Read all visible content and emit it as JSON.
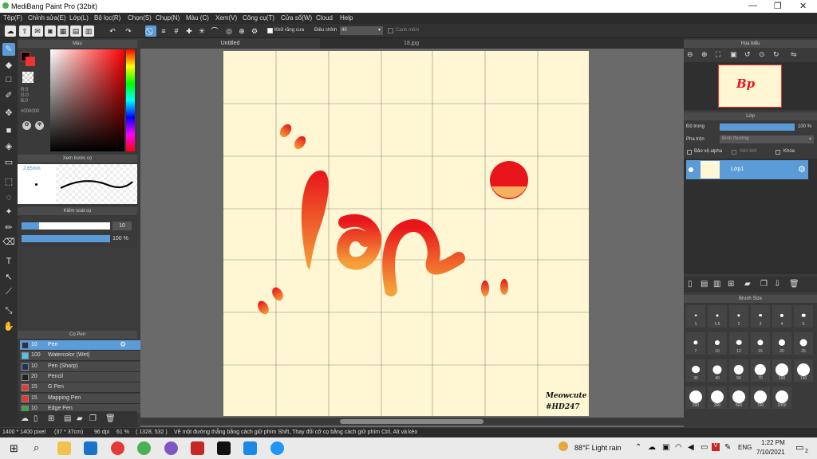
{
  "window": {
    "title": "MediBang Paint Pro (32bit)"
  },
  "menu": [
    "Tệp(F)",
    "Chỉnh sửa(E)",
    "Lớp(L)",
    "Bộ lọc(R)",
    "Chọn(S)",
    "Chụp(N)",
    "Màu (C)",
    "Xem(V)",
    "Công cụ(T)",
    "Cửa sổ(W)",
    "Cloud",
    "Help"
  ],
  "toolbar": {
    "antialias_label": "Khử răng cưa",
    "adjust_label": "Điều chỉnh",
    "adjust_value": "40",
    "canh_mem_label": "Cạnh mềm"
  },
  "color_panel": {
    "title": "Màu",
    "rgb": [
      "R:0",
      "G:0",
      "B:0"
    ],
    "hex": "#000000"
  },
  "brush_preview": {
    "title": "Xem trước cọ",
    "size": "2.65mm"
  },
  "brush_control": {
    "title": "Kiểm soát cọ",
    "size_value": "10",
    "opacity_value": "100 %"
  },
  "brush_list": {
    "title": "Cọ Pen",
    "items": [
      {
        "size": "10",
        "name": "Pen",
        "color": "#223355"
      },
      {
        "size": "100",
        "name": "Watercolor (Wet)",
        "color": "#4fc3e8"
      },
      {
        "size": "10",
        "name": "Pen (Sharp)",
        "color": "#223355"
      },
      {
        "size": "20",
        "name": "Pencil",
        "color": "#222222"
      },
      {
        "size": "15",
        "name": "G Pen",
        "color": "#e53935"
      },
      {
        "size": "15",
        "name": "Mapping Pen",
        "color": "#e53935"
      },
      {
        "size": "10",
        "name": "Edge Pen",
        "color": "#43a047"
      }
    ]
  },
  "tabs": [
    "Untitled",
    "18.jpg"
  ],
  "canvas": {
    "signature_line1": "Meowcute",
    "signature_line2": "#HD247",
    "art_text": "Bp"
  },
  "navigator": {
    "title": "Họa biểu"
  },
  "layer_panel": {
    "title": "Lớp",
    "opacity_label": "Độ trong",
    "opacity_value": "100 %",
    "blend_label": "Pha trộn",
    "blend_value": "Bình thường",
    "protect_alpha": "Bảo vệ alpha",
    "clipping": "Xén bớt",
    "lock": "Khóa",
    "layer_name": "Lớp1"
  },
  "brush_size": {
    "title": "Brush Size",
    "sizes": [
      "1",
      "1.5",
      "2",
      "3",
      "4",
      "5",
      "7",
      "10",
      "12",
      "15",
      "20",
      "25",
      "30",
      "40",
      "50",
      "70",
      "100",
      "150",
      "200",
      "300",
      "500",
      "700",
      "1000"
    ]
  },
  "status": {
    "dimensions": "1400 * 1400 pixel",
    "cm": "(37 * 37cm)",
    "dpi": "96 dpi",
    "zoom": "61 %",
    "coords": "( 1328, 532 )",
    "hint": "Vẽ một đường thẳng bằng cách giữ phím Shift, Thay đổi cỡ cọ bằng cách giữ phím Ctrl, Alt và kéo"
  },
  "taskbar": {
    "weather": "88°F Light rain",
    "lang": "ENG",
    "time": "1:22 PM",
    "date": "7/10/2021",
    "notif": "2"
  }
}
